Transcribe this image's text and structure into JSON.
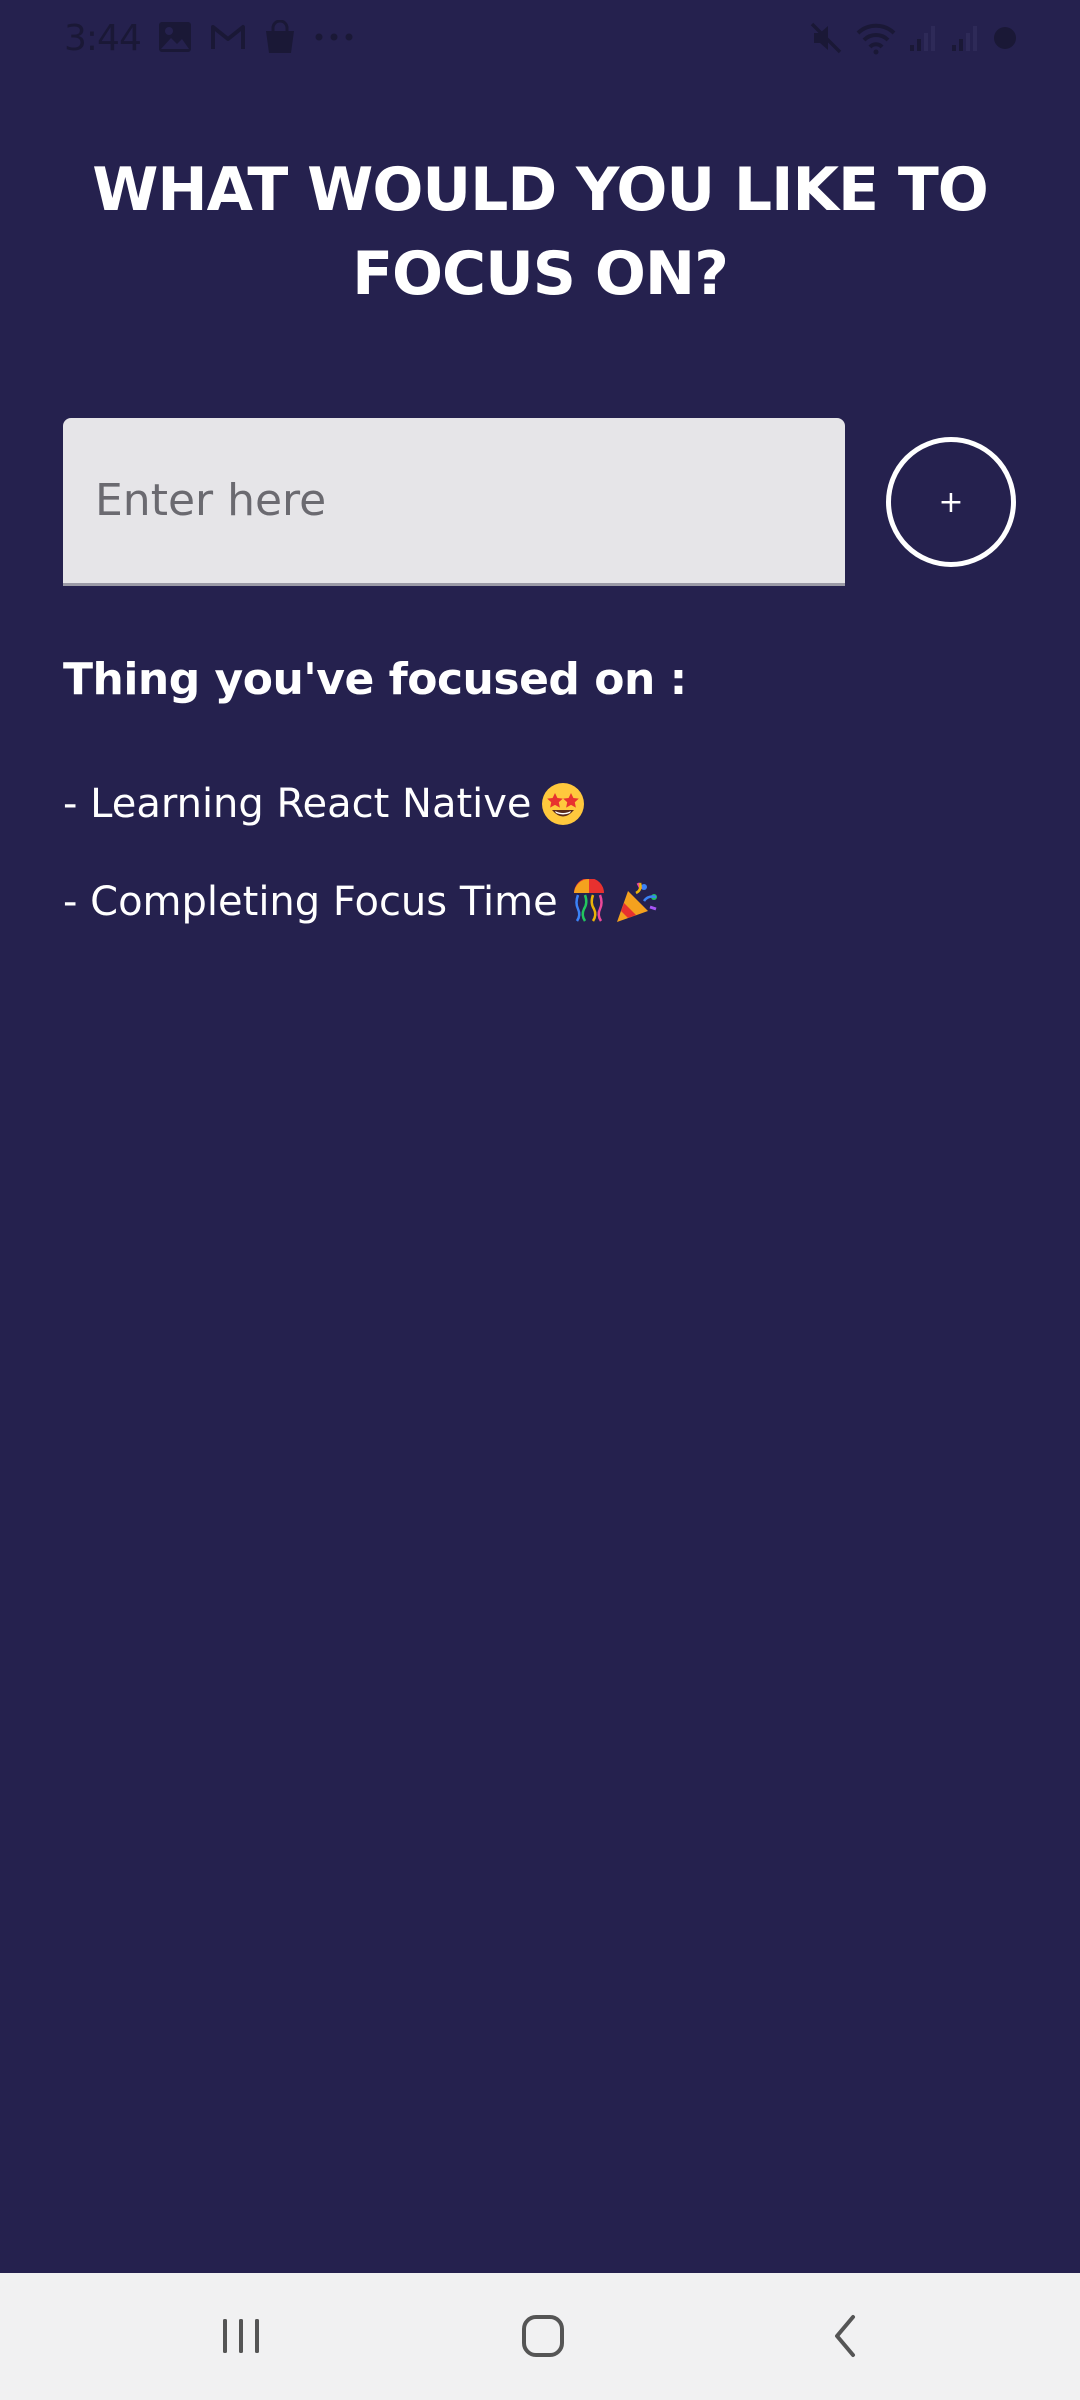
{
  "status_bar": {
    "time": "3:44",
    "left_icons": [
      "image-icon",
      "gmail-icon",
      "shopping-bag-icon",
      "more-dots-icon"
    ],
    "right_icons": [
      "mute-icon",
      "wifi-icon",
      "signal-icon",
      "signal-icon",
      "battery-icon"
    ]
  },
  "page": {
    "title": "WHAT WOULD YOU LIKE TO FOCUS ON?"
  },
  "input": {
    "placeholder": "Enter here",
    "value": ""
  },
  "add_button": {
    "label": "+"
  },
  "history": {
    "heading": "Thing you've focused on :",
    "items": [
      {
        "text": "- Learning React Native",
        "emojis": [
          "star-struck-icon"
        ]
      },
      {
        "text": "- Completing Focus Time",
        "emojis": [
          "confetti-ball-icon",
          "party-popper-icon"
        ]
      }
    ]
  },
  "nav_bar": {
    "buttons": [
      "recent-apps-icon",
      "home-icon",
      "back-icon"
    ]
  },
  "colors": {
    "background": "#25214E",
    "text": "#FFFFFF",
    "input_bg": "#E6E5E8",
    "nav_bg": "#F1F1F2"
  }
}
